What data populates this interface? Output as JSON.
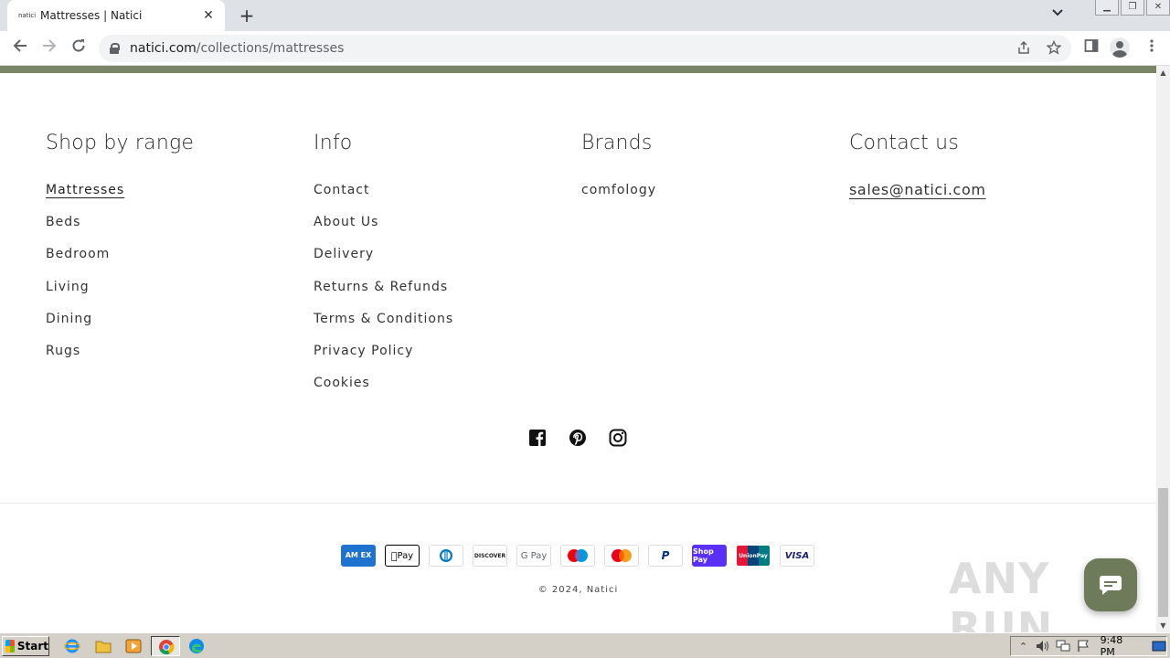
{
  "browser": {
    "tab_title": "Mattresses | Natici",
    "tab_favicon_text": "natici",
    "url_host": "natici.com",
    "url_path": "/collections/mattresses"
  },
  "footer": {
    "shop_by_range": {
      "title": "Shop by range",
      "items": [
        "Mattresses",
        "Beds",
        "Bedroom",
        "Living",
        "Dining",
        "Rugs"
      ]
    },
    "info": {
      "title": "Info",
      "items": [
        "Contact",
        "About Us",
        "Delivery",
        "Returns & Refunds",
        "Terms & Conditions",
        "Privacy Policy",
        "Cookies"
      ]
    },
    "brands": {
      "title": "Brands",
      "items": [
        "comfology"
      ]
    },
    "contact": {
      "title": "Contact us",
      "email": "sales@natici.com"
    },
    "socials": [
      "facebook-icon",
      "pinterest-icon",
      "instagram-icon"
    ],
    "payments": {
      "amex": "AM EX",
      "applepay": "Pay",
      "discover": "DISCOVER",
      "gpay": "G Pay",
      "paypal": "P",
      "shoppay": "Shop Pay",
      "unionpay": "UnionPay",
      "visa": "VISA"
    },
    "copyright_prefix": "© 2024, ",
    "copyright_brand": "Natici"
  },
  "watermark": "ANY RUN",
  "taskbar": {
    "start_label": "Start",
    "clock": "9:48 PM"
  },
  "colors": {
    "accent": "#7a8467",
    "chat": "#6d7b5a"
  }
}
